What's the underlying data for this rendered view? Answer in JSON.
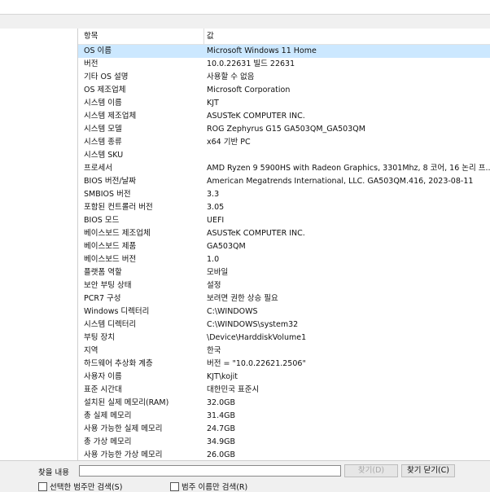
{
  "header": {
    "col_item": "항목",
    "col_value": "값"
  },
  "rows": [
    {
      "item": "OS 이름",
      "value": "Microsoft Windows 11 Home"
    },
    {
      "item": "버전",
      "value": "10.0.22631 빌드 22631"
    },
    {
      "item": "기타 OS 설명",
      "value": "사용할 수 없음"
    },
    {
      "item": "OS 제조업체",
      "value": "Microsoft Corporation"
    },
    {
      "item": "시스템 이름",
      "value": "KJT"
    },
    {
      "item": "시스템 제조업체",
      "value": "ASUSTeK COMPUTER INC."
    },
    {
      "item": "시스템 모델",
      "value": "ROG Zephyrus G15 GA503QM_GA503QM"
    },
    {
      "item": "시스템 종류",
      "value": "x64 기반 PC"
    },
    {
      "item": "시스템 SKU",
      "value": ""
    },
    {
      "item": "프로세서",
      "value": "AMD Ryzen 9 5900HS with Radeon Graphics, 3301Mhz, 8 코어, 16 논리 프..."
    },
    {
      "item": "BIOS 버전/날짜",
      "value": "American Megatrends International, LLC. GA503QM.416, 2023-08-11"
    },
    {
      "item": "SMBIOS 버전",
      "value": "3.3"
    },
    {
      "item": "포함된 컨트롤러 버전",
      "value": "3.05"
    },
    {
      "item": "BIOS 모드",
      "value": "UEFI"
    },
    {
      "item": "베이스보드 제조업체",
      "value": "ASUSTeK COMPUTER INC."
    },
    {
      "item": "베이스보드 제품",
      "value": "GA503QM"
    },
    {
      "item": "베이스보드 버전",
      "value": "1.0"
    },
    {
      "item": "플랫폼 역할",
      "value": "모바일"
    },
    {
      "item": "보안 부팅 상태",
      "value": "설정"
    },
    {
      "item": "PCR7 구성",
      "value": "보려면 권한 상승 필요"
    },
    {
      "item": "Windows 디렉터리",
      "value": "C:\\WINDOWS"
    },
    {
      "item": "시스템 디렉터리",
      "value": "C:\\WINDOWS\\system32"
    },
    {
      "item": "부팅 장치",
      "value": "\\Device\\HarddiskVolume1"
    },
    {
      "item": "지역",
      "value": "한국"
    },
    {
      "item": "하드웨어 추상화 계층",
      "value": "버전 = \"10.0.22621.2506\""
    },
    {
      "item": "사용자 이름",
      "value": "KJT\\kojit"
    },
    {
      "item": "표준 시간대",
      "value": "대한민국 표준시"
    },
    {
      "item": "설치된 실제 메모리(RAM)",
      "value": "32.0GB"
    },
    {
      "item": "총 실제 메모리",
      "value": "31.4GB"
    },
    {
      "item": "사용 가능한 실제 메모리",
      "value": "24.7GB"
    },
    {
      "item": "총 가상 메모리",
      "value": "34.9GB"
    },
    {
      "item": "사용 가능한 가상 메모리",
      "value": "26.0GB"
    }
  ],
  "selected_row": 0,
  "find": {
    "label": "찾을 내용",
    "value": "",
    "find_button": "찾기(D)",
    "close_find_button": "찾기 닫기(C)",
    "search_selected_category": "선택한 범주만 검색(S)",
    "search_category_names": "범주 이름만 검색(R)"
  }
}
